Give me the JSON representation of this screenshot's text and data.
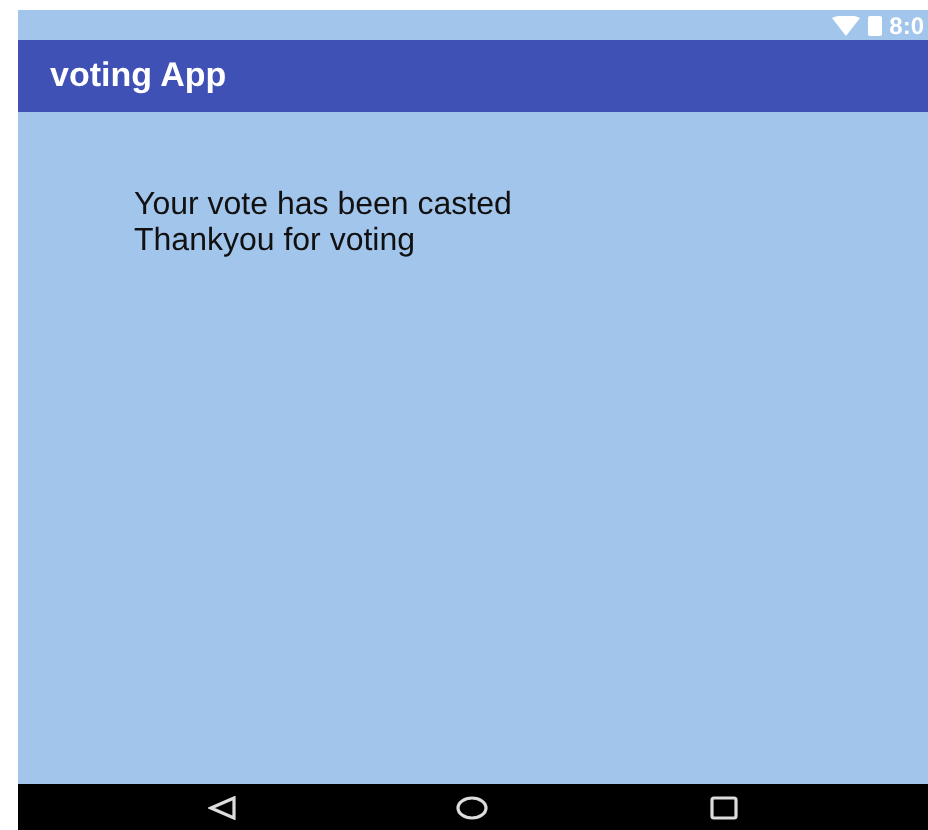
{
  "status_bar": {
    "time": "8:0"
  },
  "app_bar": {
    "title": "voting App"
  },
  "message": [
    "Your vote has been casted",
    "Thankyou for voting"
  ]
}
